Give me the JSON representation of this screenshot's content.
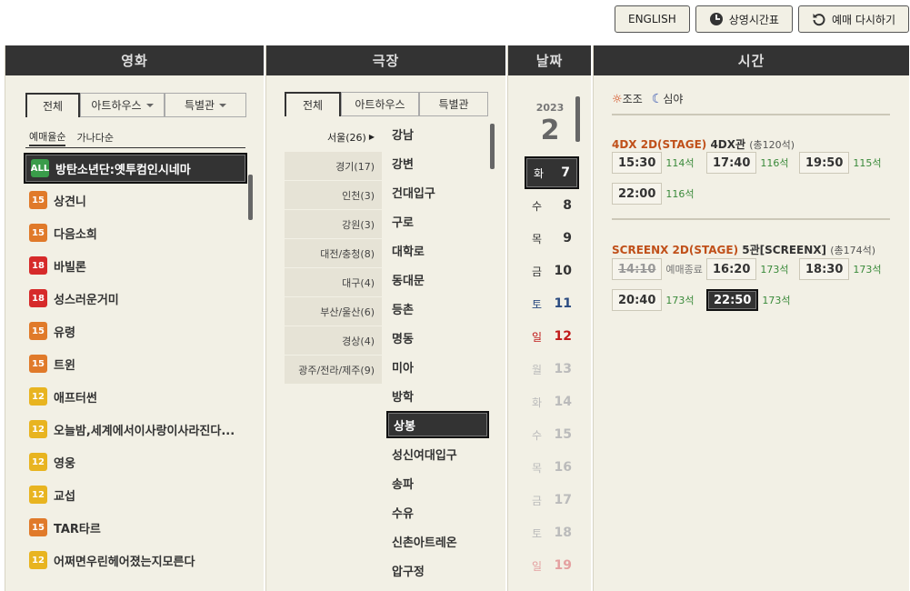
{
  "top_buttons": {
    "english": "ENGLISH",
    "schedule": "상영시간표",
    "reset": "예매 다시하기"
  },
  "columns": {
    "movie": "영화",
    "theater": "극장",
    "date": "날짜",
    "time": "시간"
  },
  "movie": {
    "tabs": [
      "전체",
      "아트하우스",
      "특별관"
    ],
    "sort": [
      "예매율순",
      "가나다순"
    ],
    "items": [
      {
        "rating": "ALL",
        "title": "방탄소년단:옛투컴인시네마"
      },
      {
        "rating": "15",
        "title": "상견니"
      },
      {
        "rating": "15",
        "title": "다음소희"
      },
      {
        "rating": "18",
        "title": "바빌론"
      },
      {
        "rating": "18",
        "title": "성스러운거미"
      },
      {
        "rating": "15",
        "title": "유령"
      },
      {
        "rating": "15",
        "title": "트윈"
      },
      {
        "rating": "12",
        "title": "애프터썬"
      },
      {
        "rating": "12",
        "title": "오늘밤,세계에서이사랑이사라진다..."
      },
      {
        "rating": "12",
        "title": "영웅"
      },
      {
        "rating": "12",
        "title": "교섭"
      },
      {
        "rating": "15",
        "title": "TAR타르"
      },
      {
        "rating": "12",
        "title": "어쩌면우린헤어졌는지모른다"
      }
    ]
  },
  "theater": {
    "tabs": [
      "전체",
      "아트하우스",
      "특별관"
    ],
    "regions": [
      "서울(26)",
      "경기(17)",
      "인천(3)",
      "강원(3)",
      "대전/충청(8)",
      "대구(4)",
      "부산/울산(6)",
      "경상(4)",
      "광주/전라/제주(9)"
    ],
    "items": [
      "강남",
      "강변",
      "건대입구",
      "구로",
      "대학로",
      "동대문",
      "등촌",
      "명동",
      "미아",
      "방학",
      "상봉",
      "성신여대입구",
      "송파",
      "수유",
      "신촌아트레온",
      "압구정"
    ]
  },
  "date": {
    "year": "2023",
    "month": "2",
    "items": [
      {
        "dow": "화",
        "day": "7"
      },
      {
        "dow": "수",
        "day": "8"
      },
      {
        "dow": "목",
        "day": "9"
      },
      {
        "dow": "금",
        "day": "10"
      },
      {
        "dow": "토",
        "day": "11"
      },
      {
        "dow": "일",
        "day": "12"
      },
      {
        "dow": "월",
        "day": "13"
      },
      {
        "dow": "화",
        "day": "14"
      },
      {
        "dow": "수",
        "day": "15"
      },
      {
        "dow": "목",
        "day": "16"
      },
      {
        "dow": "금",
        "day": "17"
      },
      {
        "dow": "토",
        "day": "18"
      },
      {
        "dow": "일",
        "day": "19"
      }
    ]
  },
  "time": {
    "modes": {
      "morning": "조조",
      "night": "심야"
    },
    "halls": [
      {
        "format": "4DX 2D(STAGE)",
        "name": "4DX관",
        "seats": "(총120석)",
        "slots": [
          {
            "t": "15:30",
            "r": "114석"
          },
          {
            "t": "17:40",
            "r": "116석"
          },
          {
            "t": "19:50",
            "r": "115석"
          },
          {
            "t": "22:00",
            "r": "116석"
          }
        ]
      },
      {
        "format": "SCREENX 2D(STAGE)",
        "name": "5관[SCREENX]",
        "seats": "(총174석)",
        "slots": [
          {
            "t": "14:10",
            "r": "예매종료"
          },
          {
            "t": "16:20",
            "r": "173석"
          },
          {
            "t": "18:30",
            "r": "173석"
          },
          {
            "t": "20:40",
            "r": "173석"
          },
          {
            "t": "22:50",
            "r": "173석"
          }
        ]
      }
    ]
  }
}
